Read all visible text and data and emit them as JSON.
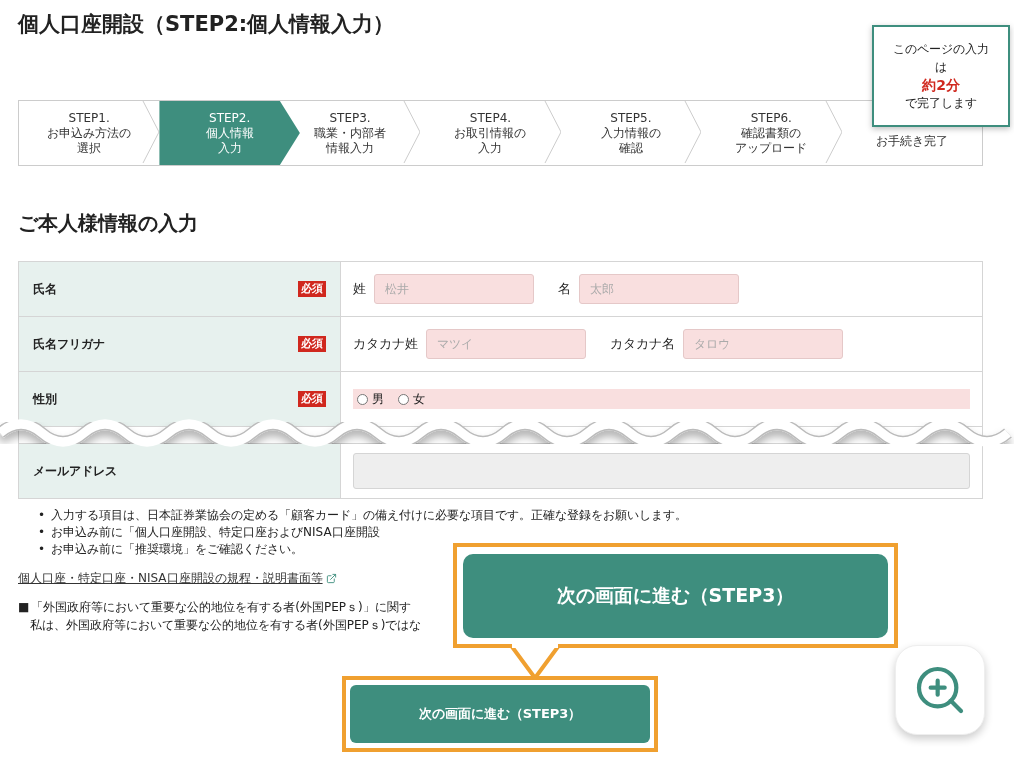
{
  "title": "個人口座開設（STEP2:個人情報入力）",
  "steps": [
    {
      "number": "STEP1.",
      "lines": [
        "お申込み方法の",
        "選択"
      ],
      "selected": false
    },
    {
      "number": "STEP2.",
      "lines": [
        "個人情報",
        "入力"
      ],
      "selected": true
    },
    {
      "number": "STEP3.",
      "lines": [
        "職業・内部者",
        "情報入力"
      ],
      "selected": false
    },
    {
      "number": "STEP4.",
      "lines": [
        "お取引情報の",
        "入力"
      ],
      "selected": false
    },
    {
      "number": "STEP5.",
      "lines": [
        "入力情報の",
        "確認"
      ],
      "selected": false
    },
    {
      "number": "STEP6.",
      "lines": [
        "確認書類の",
        "アップロード"
      ],
      "selected": false
    },
    {
      "lines": [
        "お手続き完了"
      ],
      "selected": false
    }
  ],
  "time_notice": {
    "lines": [
      {
        "text": "このページの入力",
        "kind": "normal"
      },
      {
        "text": "は",
        "kind": "normal"
      },
      {
        "text": "約2分",
        "kind": "emphasis"
      },
      {
        "text": "で完了します",
        "kind": "normal"
      }
    ]
  },
  "section_title": "ご本人様情報の入力",
  "form_rows": [
    {
      "label": "氏名",
      "required": "必須",
      "kind": "text",
      "fields": [
        {
          "label": "姓",
          "placeholder": "松井"
        },
        {
          "label": "名",
          "placeholder": "太郎"
        }
      ]
    },
    {
      "label": "氏名フリガナ",
      "required": "必須",
      "kind": "text",
      "fields": [
        {
          "label": "カタカナ姓",
          "placeholder": "マツイ"
        },
        {
          "label": "カタカナ名",
          "placeholder": "タロウ"
        }
      ]
    },
    {
      "label": "性別",
      "required": "必須",
      "kind": "radio",
      "options": [
        {
          "label": "男",
          "checked": false
        },
        {
          "label": "女",
          "checked": false
        }
      ]
    },
    {
      "kind": "break"
    },
    {
      "label": "メールアドレス",
      "kind": "email"
    }
  ],
  "notes": [
    {
      "marker": "•",
      "text": "入力する項目は、日本証券業協会の定める「顧客カード」の備え付けに必要な項目です。正確な登録をお願いします。"
    },
    {
      "marker": "•",
      "text": "お申込み前に「個人口座開設、特定口座およびNISA口座開設"
    },
    {
      "marker": "•",
      "text": "お申込み前に「推奨環境」をご確認ください。"
    }
  ],
  "documents_link": "個人口座・特定口座・NISA口座開設の規程・説明書面等",
  "pep": {
    "marker": "■",
    "heading": "「外国政府等において重要な公的地位を有する者(外国PEPｓ)」に関す",
    "statement": "私は、外国政府等において重要な公的地位を有する者(外国PEPｓ)ではな"
  },
  "next_button": "次の画面に進む（STEP3）",
  "callout_button": "次の画面に進む（STEP3）"
}
